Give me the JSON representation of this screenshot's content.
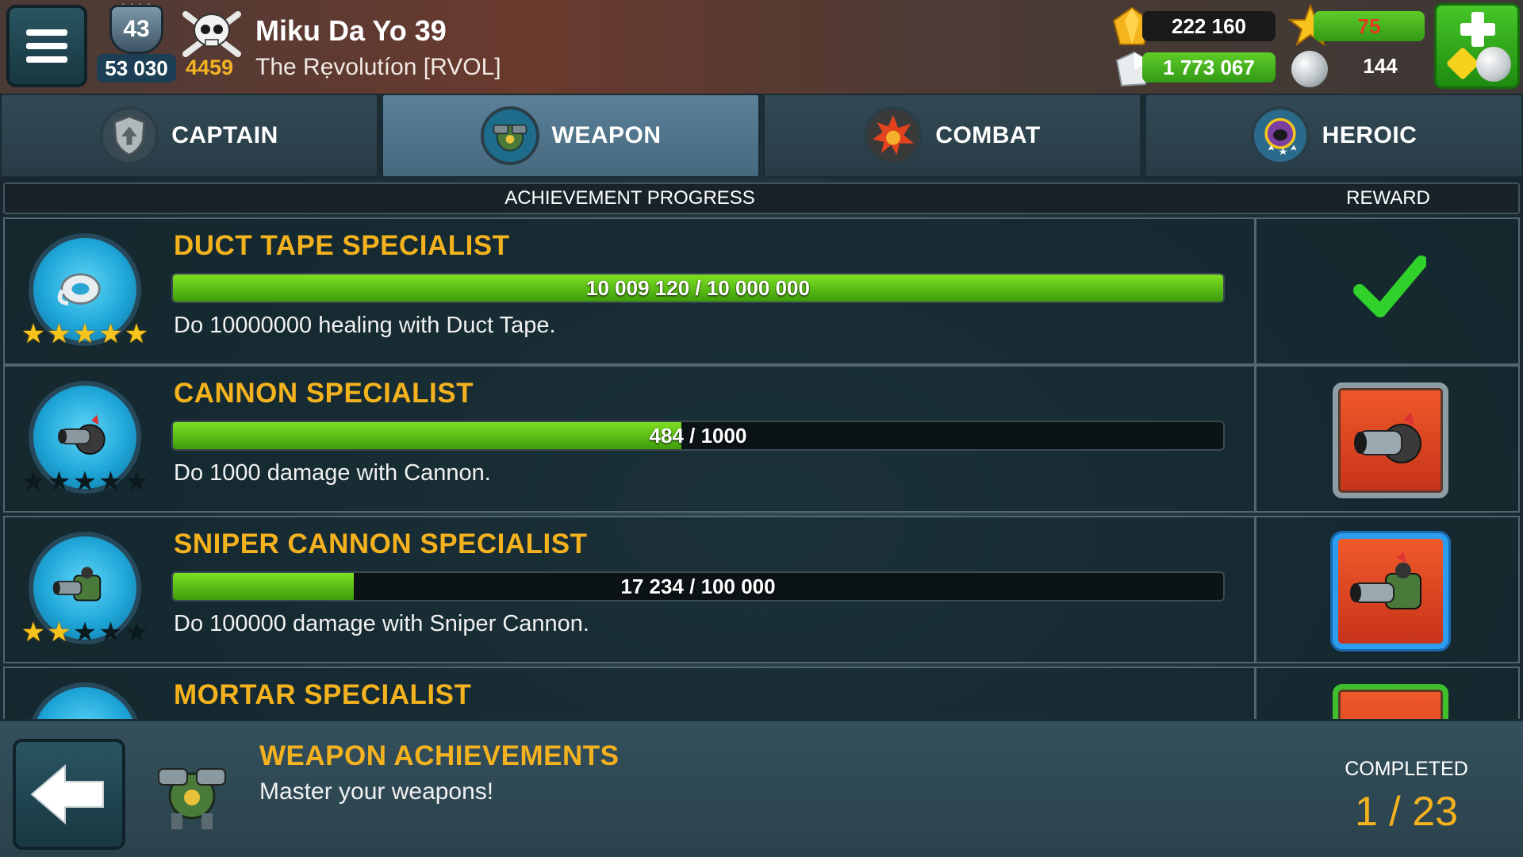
{
  "player": {
    "level": "43",
    "trophies": "53 030",
    "skull_count": "4459",
    "name": "Miku Da Yo 39",
    "alliance": "The Rẹvolutíon [RVOL]"
  },
  "resources": {
    "gold": "222 160",
    "silver": "1 773 067",
    "energy": "75",
    "pearls": "144"
  },
  "tabs": [
    {
      "label": "CAPTAIN",
      "icon": "captain-shield-icon",
      "active": false
    },
    {
      "label": "WEAPON",
      "icon": "weapon-turret-icon",
      "active": true
    },
    {
      "label": "COMBAT",
      "icon": "combat-explosion-icon",
      "active": false
    },
    {
      "label": "HEROIC",
      "icon": "heroic-helmet-icon",
      "active": false
    }
  ],
  "table": {
    "progress_header": "ACHIEVEMENT PROGRESS",
    "reward_header": "REWARD"
  },
  "achievements": [
    {
      "title": "DUCT TAPE SPECIALIST",
      "progress_text": "10 009 120 / 10 000 000",
      "progress": 1.0,
      "description": "Do 10000000 healing with Duct Tape.",
      "stars": 5,
      "icon": "duct-tape-icon",
      "reward": "claimed-checkmark"
    },
    {
      "title": "CANNON SPECIALIST",
      "progress_text": "484 / 1000",
      "progress": 0.484,
      "description": "Do 1000 damage with Cannon.",
      "stars": 0,
      "icon": "cannon-icon",
      "reward": "cannon-reward-card"
    },
    {
      "title": "SNIPER CANNON SPECIALIST",
      "progress_text": "17 234 / 100 000",
      "progress": 0.17234,
      "description": "Do 100000 damage with Sniper Cannon.",
      "stars": 2,
      "icon": "sniper-cannon-icon",
      "reward": "sniper-cannon-reward-card"
    },
    {
      "title": "MORTAR SPECIALIST",
      "progress_text": "",
      "progress": null,
      "description": "",
      "stars": 0,
      "icon": "mortar-icon",
      "reward": "mortar-reward-card"
    }
  ],
  "footer": {
    "title": "WEAPON ACHIEVEMENTS",
    "subtitle": "Master your weapons!",
    "completed_label": "COMPLETED",
    "completed_value": "1 / 23"
  },
  "colors": {
    "title_gold": "#f4b21e",
    "progress_green": "#6fd31c",
    "active_tab": "#5a8098"
  }
}
